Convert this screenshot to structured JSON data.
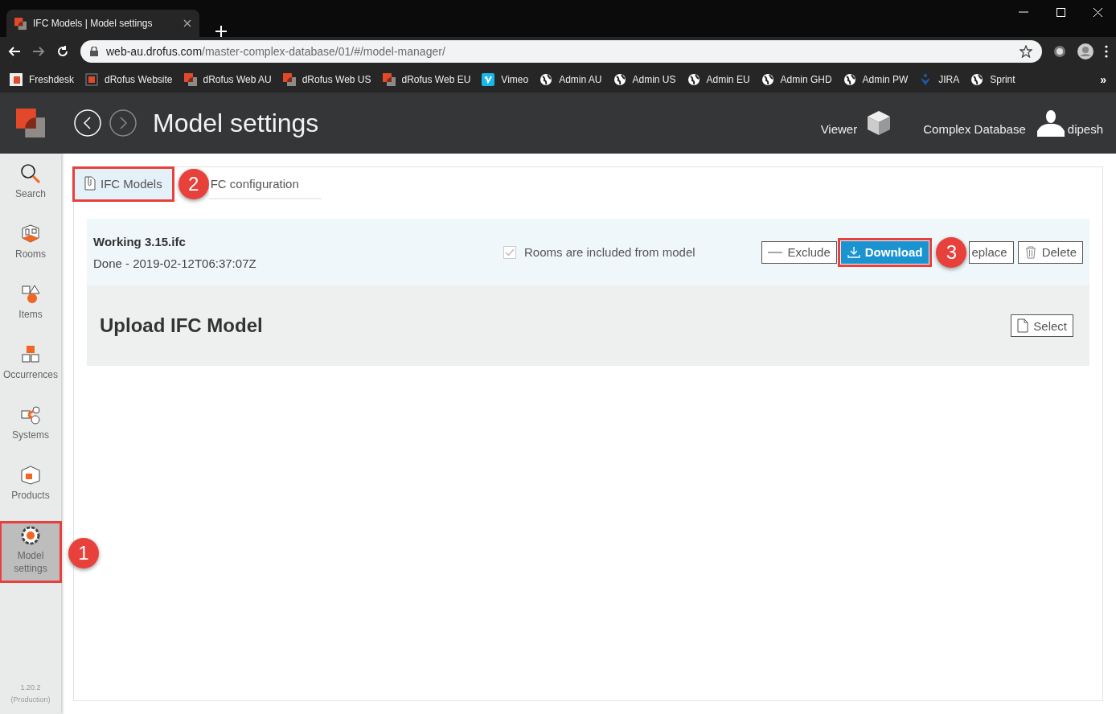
{
  "browser": {
    "tab_title": "IFC Models | Model settings",
    "url_host": "web-au.drofus.com",
    "url_path": "/master-complex-database/01/#/model-manager/",
    "bookmarks": [
      {
        "label": "Freshdesk",
        "kind": "freshdesk"
      },
      {
        "label": "dRofus Website",
        "kind": "website"
      },
      {
        "label": "dRofus Web AU",
        "kind": "drofus"
      },
      {
        "label": "dRofus Web US",
        "kind": "drofus"
      },
      {
        "label": "dRofus Web EU",
        "kind": "drofus"
      },
      {
        "label": "Vimeo",
        "kind": "vimeo"
      },
      {
        "label": "Admin AU",
        "kind": "globe"
      },
      {
        "label": "Admin US",
        "kind": "globe"
      },
      {
        "label": "Admin EU",
        "kind": "globe"
      },
      {
        "label": "Admin GHD",
        "kind": "globe"
      },
      {
        "label": "Admin PW",
        "kind": "globe"
      },
      {
        "label": "JIRA",
        "kind": "jira"
      },
      {
        "label": "Sprint",
        "kind": "globe"
      }
    ],
    "more": "»"
  },
  "header": {
    "title": "Model settings",
    "viewer": "Viewer",
    "database": "Complex Database",
    "user": "dipesh"
  },
  "sidebar": {
    "items": [
      {
        "label": "Search",
        "selected": false
      },
      {
        "label": "Rooms",
        "selected": false
      },
      {
        "label": "Items",
        "selected": false
      },
      {
        "label": "Occurrences",
        "selected": false
      },
      {
        "label": "Systems",
        "selected": false
      },
      {
        "label": "Products",
        "selected": false
      },
      {
        "label": "Model settings",
        "selected": true,
        "callout": "1"
      }
    ],
    "version": "1.20.2",
    "build": "(Production)"
  },
  "tabs": [
    {
      "label": "IFC Models",
      "selected": true,
      "callout": "2"
    },
    {
      "label": "FC configuration",
      "selected": false
    }
  ],
  "model": {
    "name": "Working 3.15.ifc",
    "status": "Done - 2019-02-12T06:37:07Z",
    "rooms_option": {
      "label": "Rooms are included from model",
      "checked": true,
      "disabled": true
    },
    "actions": [
      {
        "label": "Exclude",
        "primary": false
      },
      {
        "label": "Download",
        "primary": true,
        "callout": "3"
      },
      {
        "label": "eplace",
        "primary": false
      },
      {
        "label": "Delete",
        "primary": false
      }
    ]
  },
  "upload": {
    "title": "Upload IFC Model",
    "button": "Select"
  }
}
